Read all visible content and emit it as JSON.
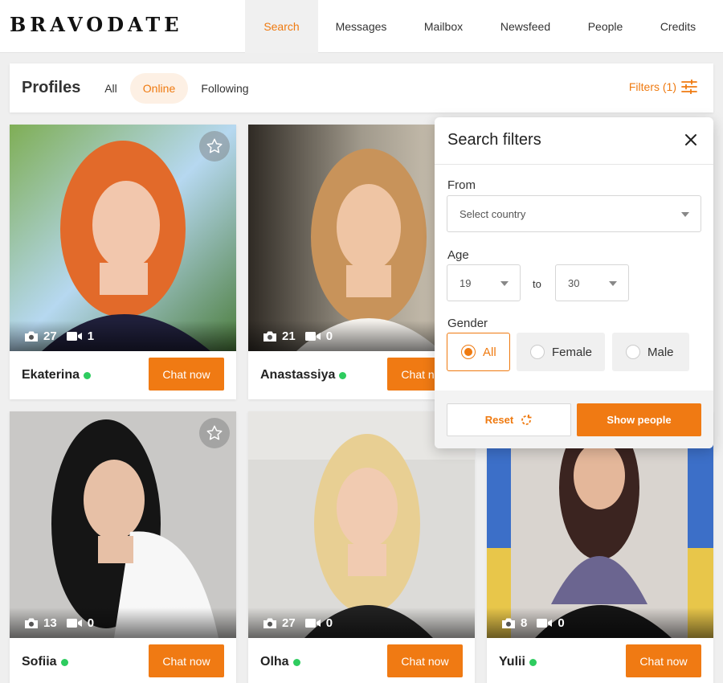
{
  "brand": {
    "logo": "BRAVODATE"
  },
  "nav": {
    "items": [
      {
        "label": "Search",
        "active": true
      },
      {
        "label": "Messages",
        "active": false
      },
      {
        "label": "Mailbox",
        "active": false
      },
      {
        "label": "Newsfeed",
        "active": false
      },
      {
        "label": "People",
        "active": false
      },
      {
        "label": "Credits",
        "active": false
      }
    ]
  },
  "profiles_bar": {
    "title": "Profiles",
    "tabs": [
      {
        "label": "All",
        "active": false
      },
      {
        "label": "Online",
        "active": true
      },
      {
        "label": "Following",
        "active": false
      }
    ],
    "filters_label": "Filters (1)",
    "filters_icon": "sliders-icon"
  },
  "profiles": [
    {
      "name": "Ekaterina",
      "photos": "27",
      "videos": "1",
      "online": true,
      "favorite_visible": true
    },
    {
      "name": "Anastassiya",
      "photos": "21",
      "videos": "0",
      "online": true,
      "favorite_visible": false
    },
    {
      "name": "Sofiia",
      "photos": "13",
      "videos": "0",
      "online": true,
      "favorite_visible": true
    },
    {
      "name": "Olha",
      "photos": "27",
      "videos": "0",
      "online": true,
      "favorite_visible": false
    },
    {
      "name": "Yulii",
      "photos": "8",
      "videos": "0",
      "online": true,
      "favorite_visible": false
    }
  ],
  "card": {
    "chat_label": "Chat now"
  },
  "filter_panel": {
    "title": "Search filters",
    "from_label": "From",
    "country_placeholder": "Select country",
    "age_label": "Age",
    "age_from": "19",
    "age_to_word": "to",
    "age_to": "30",
    "gender_label": "Gender",
    "gender_options": [
      {
        "label": "All",
        "selected": true
      },
      {
        "label": "Female",
        "selected": false
      },
      {
        "label": "Male",
        "selected": false
      }
    ],
    "reset_label": "Reset",
    "show_label": "Show people"
  },
  "colors": {
    "accent": "#ef7a10",
    "online": "#2ecc5f"
  }
}
